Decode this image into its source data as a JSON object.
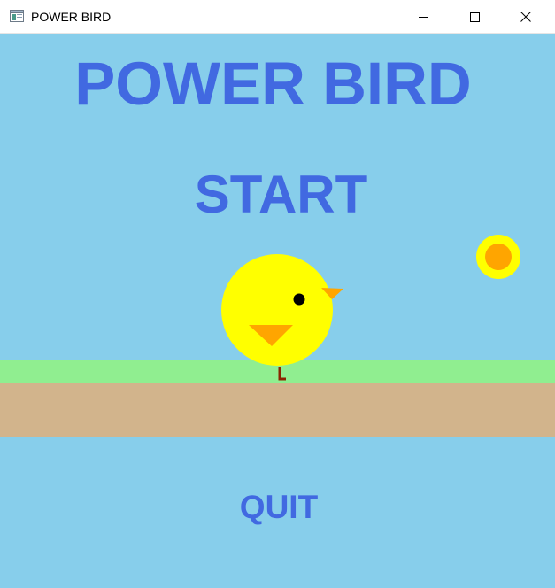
{
  "window": {
    "title": "POWER BIRD",
    "icon": "app-window-icon",
    "controls": [
      "minimize-icon",
      "maximize-icon",
      "close-icon"
    ]
  },
  "game": {
    "title": "POWER BIRD",
    "start_label": "START",
    "quit_label": "QUIT"
  },
  "colors": {
    "sky": "#87ceeb",
    "text": "#4169e1",
    "grass": "#90ee90",
    "dirt": "#d2b48c",
    "bird_body": "#ffff00",
    "bird_beak": "#ffa500",
    "bird_leg": "#8b2500",
    "sun_outer": "#ffff00",
    "sun_inner": "#ffa500"
  }
}
